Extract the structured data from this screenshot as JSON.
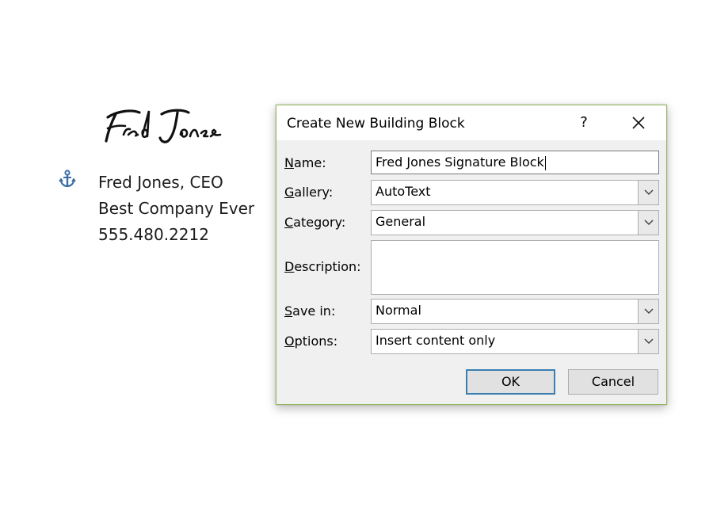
{
  "document": {
    "signature_image": "Fred Jones",
    "lines": [
      "Fred Jones, CEO",
      "Best Company Ever",
      "555.480.2212"
    ],
    "anchor_icon": "anchor-icon"
  },
  "dialog": {
    "title": "Create New Building Block",
    "help_label": "?",
    "fields": {
      "name": {
        "label_hotkey": "N",
        "label_rest": "ame:",
        "value": "Fred Jones Signature Block"
      },
      "gallery": {
        "label_hotkey": "G",
        "label_rest": "allery:",
        "value": "AutoText"
      },
      "category": {
        "label_hotkey": "C",
        "label_rest": "ategory:",
        "value": "General"
      },
      "description": {
        "label_hotkey": "D",
        "label_rest": "escription:",
        "value": ""
      },
      "save_in": {
        "label_hotkey": "S",
        "label_rest": "ave in:",
        "value": "Normal"
      },
      "options": {
        "label_hotkey": "O",
        "label_rest": "ptions:",
        "value": "Insert content only"
      }
    },
    "ok_label": "OK",
    "cancel_label": "Cancel"
  },
  "colors": {
    "dialog_border": "#92b85c",
    "ok_border": "#3c7fb1",
    "anchor": "#3a6ea5"
  }
}
